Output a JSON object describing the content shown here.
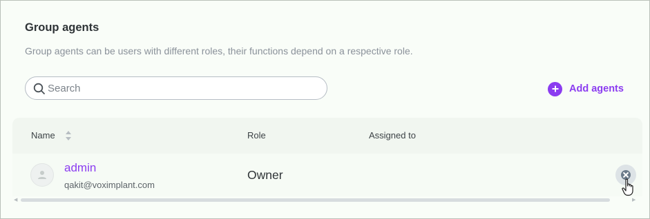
{
  "section": {
    "title": "Group agents",
    "description": "Group agents can be users with different roles, their functions depend on a respective role."
  },
  "search": {
    "placeholder": "Search",
    "value": "",
    "icon": "search-icon"
  },
  "add_agents": {
    "label": "Add agents",
    "icon": "plus-circle-icon"
  },
  "table": {
    "columns": [
      "Name",
      "Role",
      "Assigned to"
    ],
    "rows": [
      {
        "name": "admin",
        "email": "qakit@voximplant.com",
        "role": "Owner",
        "assigned_to": ""
      }
    ]
  },
  "colors": {
    "accent": "#8b3cf0",
    "panel_background": "#f9fdf8",
    "header_background": "#f1f6f0",
    "remove_icon": "#6b7b8a"
  }
}
